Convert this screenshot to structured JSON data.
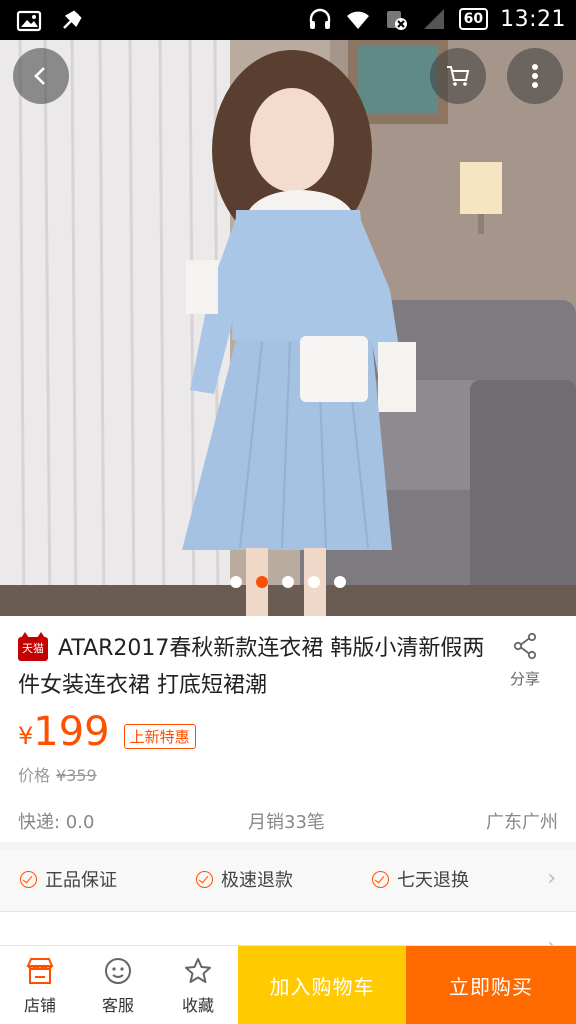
{
  "status_bar": {
    "time": "13:21",
    "battery": "60",
    "icons": [
      "gallery-icon",
      "usb-debug-icon",
      "headset-icon",
      "wifi-icon",
      "no-sim-icon",
      "signal-icon"
    ]
  },
  "hero": {
    "buttons": [
      "back-icon",
      "cart-icon",
      "more-icon"
    ],
    "carousel": {
      "total": 5,
      "active_index": 1
    }
  },
  "product": {
    "badge": "天猫",
    "title": "ATAR2017春秋新款连衣裙 韩版小清新假两件女装连衣裙 打底短裙潮",
    "share_label": "分享",
    "price_currency": "¥",
    "price": "199",
    "promo_tag": "上新特惠",
    "original_price_label": "价格",
    "original_price": "¥359",
    "shipping": "快递: 0.0",
    "monthly_sales": "月销33笔",
    "location": "广东广州"
  },
  "guarantees": {
    "items": [
      "正品保证",
      "极速退款",
      "七天退换"
    ]
  },
  "bottom_bar": {
    "shop_label": "店铺",
    "service_label": "客服",
    "favorite_label": "收藏",
    "add_to_cart": "加入购物车",
    "buy_now": "立即购买"
  },
  "colors": {
    "accent": "#ff5000",
    "cart_button": "#ffcb00",
    "buy_button": "#ff6a00",
    "dress": "#a9c6e6"
  }
}
